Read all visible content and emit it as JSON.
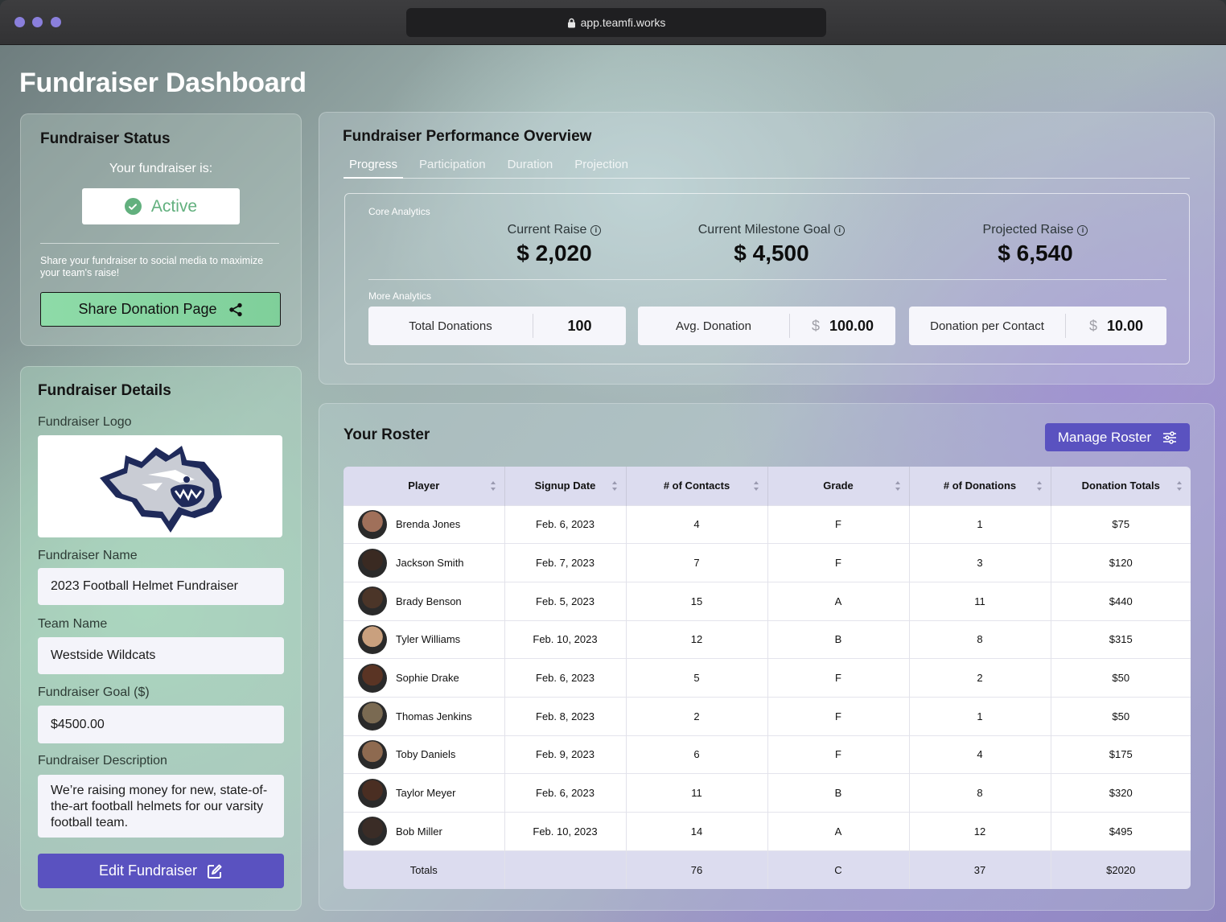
{
  "browser": {
    "url": "app.teamfi.works"
  },
  "page": {
    "title": "Fundraiser Dashboard"
  },
  "status": {
    "title": "Fundraiser Status",
    "subtitle": "Your fundraiser is:",
    "state": "Active",
    "share_text": "Share your fundraiser to social media to maximize your team's raise!",
    "share_button": "Share Donation Page"
  },
  "details": {
    "title": "Fundraiser Details",
    "logo_label": "Fundraiser Logo",
    "name_label": "Fundraiser Name",
    "name_value": "2023 Football Helmet Fundraiser",
    "team_label": "Team Name",
    "team_value": "Westside Wildcats",
    "goal_label": "Fundraiser Goal ($)",
    "goal_value": "$4500.00",
    "description_label": "Fundraiser Description",
    "description_value": "We’re raising money for new, state-of-the-art football helmets for our varsity football team.",
    "edit_button": "Edit Fundraiser"
  },
  "performance": {
    "title": "Fundraiser Performance Overview",
    "tabs": [
      "Progress",
      "Participation",
      "Duration",
      "Projection"
    ],
    "active_tab": "Progress",
    "core_label": "Core Analytics",
    "metrics": [
      {
        "label": "Current Raise",
        "value": "$ 2,020"
      },
      {
        "label": "Current Milestone Goal",
        "value": "$ 4,500"
      },
      {
        "label": "Projected Raise",
        "value": "$ 6,540"
      }
    ],
    "more_label": "More Analytics",
    "stats": [
      {
        "label": "Total Donations",
        "currency": "",
        "value": "100"
      },
      {
        "label": "Avg. Donation",
        "currency": "$",
        "value": "100.00"
      },
      {
        "label": "Donation per Contact",
        "currency": "$",
        "value": "10.00"
      }
    ]
  },
  "roster": {
    "title": "Your Roster",
    "manage_button": "Manage Roster",
    "columns": [
      "Player",
      "Signup Date",
      "# of Contacts",
      "Grade",
      "# of Donations",
      "Donation Totals"
    ],
    "rows": [
      {
        "player": "Brenda Jones",
        "date": "Feb. 6, 2023",
        "contacts": "4",
        "grade": "F",
        "donations": "1",
        "total": "$75",
        "avatar_color": "#a0705a"
      },
      {
        "player": "Jackson Smith",
        "date": "Feb. 7, 2023",
        "contacts": "7",
        "grade": "F",
        "donations": "3",
        "total": "$120",
        "avatar_color": "#3a2a22"
      },
      {
        "player": "Brady Benson",
        "date": "Feb. 5, 2023",
        "contacts": "15",
        "grade": "A",
        "donations": "11",
        "total": "$440",
        "avatar_color": "#4b3528"
      },
      {
        "player": "Tyler Williams",
        "date": "Feb. 10, 2023",
        "contacts": "12",
        "grade": "B",
        "donations": "8",
        "total": "$315",
        "avatar_color": "#c9a07e"
      },
      {
        "player": "Sophie Drake",
        "date": "Feb. 6, 2023",
        "contacts": "5",
        "grade": "F",
        "donations": "2",
        "total": "$50",
        "avatar_color": "#5a3424"
      },
      {
        "player": "Thomas Jenkins",
        "date": "Feb. 8, 2023",
        "contacts": "2",
        "grade": "F",
        "donations": "1",
        "total": "$50",
        "avatar_color": "#7a6a52"
      },
      {
        "player": "Toby Daniels",
        "date": "Feb. 9, 2023",
        "contacts": "6",
        "grade": "F",
        "donations": "4",
        "total": "$175",
        "avatar_color": "#8e6a50"
      },
      {
        "player": "Taylor Meyer",
        "date": "Feb. 6, 2023",
        "contacts": "11",
        "grade": "B",
        "donations": "8",
        "total": "$320",
        "avatar_color": "#4a2e22"
      },
      {
        "player": "Bob Miller",
        "date": "Feb. 10, 2023",
        "contacts": "14",
        "grade": "A",
        "donations": "12",
        "total": "$495",
        "avatar_color": "#3a2c26"
      }
    ],
    "totals": {
      "label": "Totals",
      "date": "",
      "contacts": "76",
      "grade": "C",
      "donations": "37",
      "total": "$2020"
    }
  },
  "colors": {
    "accent": "#5a52c0",
    "active_green": "#62b07e",
    "share_green": "#8edba8"
  }
}
